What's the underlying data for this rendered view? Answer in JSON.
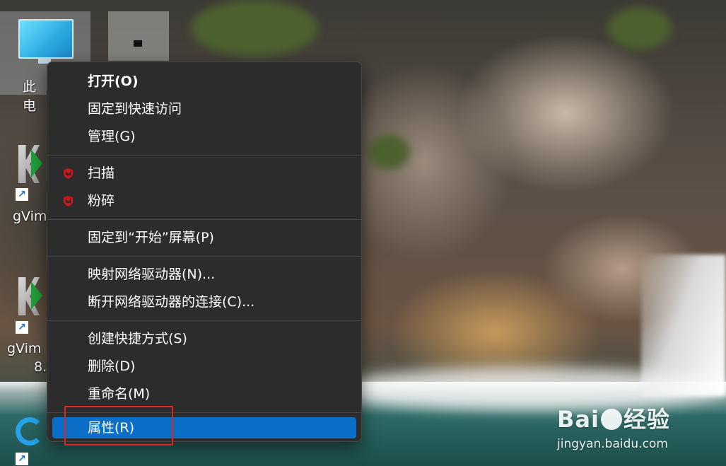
{
  "desktop": {
    "icons": [
      {
        "label": "此电"
      },
      {
        "label": ""
      },
      {
        "label": "gVim"
      },
      {
        "label": "gVim"
      },
      {
        "label_line2": "8."
      }
    ]
  },
  "context_menu": {
    "items": [
      {
        "label": "打开(O)",
        "bold": true
      },
      {
        "label": "固定到快速访问"
      },
      {
        "label": "管理(G)"
      },
      {
        "label": "扫描",
        "icon": "mcafee-shield-icon"
      },
      {
        "label": "粉碎",
        "icon": "mcafee-shield-icon"
      },
      {
        "label": "固定到“开始”屏幕(P)"
      },
      {
        "label": "映射网络驱动器(N)..."
      },
      {
        "label": "断开网络驱动器的连接(C)..."
      },
      {
        "label": "创建快捷方式(S)"
      },
      {
        "label": "删除(D)"
      },
      {
        "label": "重命名(M)"
      },
      {
        "label": "属性(R)",
        "highlighted": true
      }
    ],
    "highlight_color": "#0b6fc8",
    "annotation_color": "#e0251f"
  },
  "watermark": {
    "brand_left": "Bai",
    "brand_right": "经验",
    "url": "jingyan.baidu.com"
  }
}
